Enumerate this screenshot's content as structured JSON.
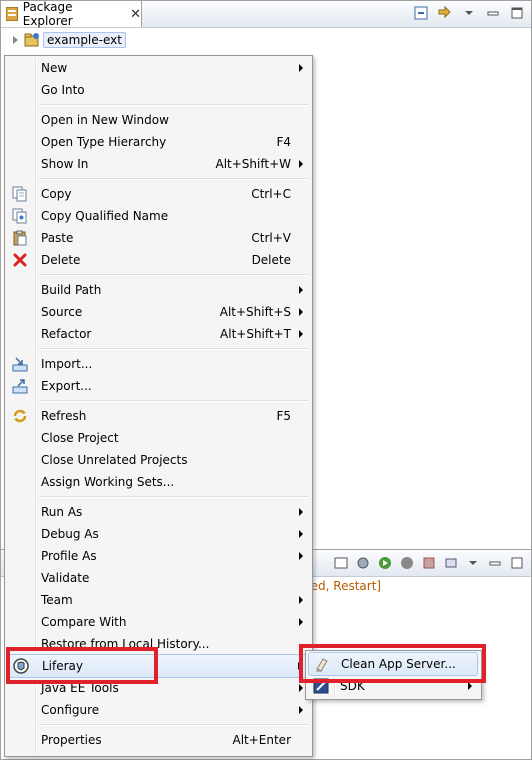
{
  "view": {
    "title": "Package Explorer",
    "close_glyph": "✕",
    "project_label": "example-ext"
  },
  "console": {
    "status_text": "rted, Restart]"
  },
  "menu": {
    "items": [
      {
        "label": "New",
        "shortcut": "",
        "submenu": true,
        "icon": ""
      },
      {
        "label": "Go Into",
        "shortcut": "",
        "submenu": false,
        "icon": ""
      },
      {
        "label": "Open in New Window",
        "shortcut": "",
        "submenu": false,
        "icon": ""
      },
      {
        "label": "Open Type Hierarchy",
        "shortcut": "F4",
        "submenu": false,
        "icon": ""
      },
      {
        "label": "Show In",
        "shortcut": "Alt+Shift+W",
        "submenu": true,
        "icon": ""
      },
      {
        "label": "Copy",
        "shortcut": "Ctrl+C",
        "submenu": false,
        "icon": "copy-icon"
      },
      {
        "label": "Copy Qualified Name",
        "shortcut": "",
        "submenu": false,
        "icon": "copy-qualified-icon"
      },
      {
        "label": "Paste",
        "shortcut": "Ctrl+V",
        "submenu": false,
        "icon": "paste-icon"
      },
      {
        "label": "Delete",
        "shortcut": "Delete",
        "submenu": false,
        "icon": "delete-icon"
      },
      {
        "label": "Build Path",
        "shortcut": "",
        "submenu": true,
        "icon": ""
      },
      {
        "label": "Source",
        "shortcut": "Alt+Shift+S",
        "submenu": true,
        "icon": ""
      },
      {
        "label": "Refactor",
        "shortcut": "Alt+Shift+T",
        "submenu": true,
        "icon": ""
      },
      {
        "label": "Import...",
        "shortcut": "",
        "submenu": false,
        "icon": "import-icon"
      },
      {
        "label": "Export...",
        "shortcut": "",
        "submenu": false,
        "icon": "export-icon"
      },
      {
        "label": "Refresh",
        "shortcut": "F5",
        "submenu": false,
        "icon": "refresh-icon"
      },
      {
        "label": "Close Project",
        "shortcut": "",
        "submenu": false,
        "icon": ""
      },
      {
        "label": "Close Unrelated Projects",
        "shortcut": "",
        "submenu": false,
        "icon": ""
      },
      {
        "label": "Assign Working Sets...",
        "shortcut": "",
        "submenu": false,
        "icon": ""
      },
      {
        "label": "Run As",
        "shortcut": "",
        "submenu": true,
        "icon": ""
      },
      {
        "label": "Debug As",
        "shortcut": "",
        "submenu": true,
        "icon": ""
      },
      {
        "label": "Profile As",
        "shortcut": "",
        "submenu": true,
        "icon": ""
      },
      {
        "label": "Validate",
        "shortcut": "",
        "submenu": false,
        "icon": ""
      },
      {
        "label": "Team",
        "shortcut": "",
        "submenu": true,
        "icon": ""
      },
      {
        "label": "Compare With",
        "shortcut": "",
        "submenu": true,
        "icon": ""
      },
      {
        "label": "Restore from Local History...",
        "shortcut": "",
        "submenu": false,
        "icon": ""
      },
      {
        "label": "Liferay",
        "shortcut": "",
        "submenu": true,
        "icon": "liferay-icon"
      },
      {
        "label": "Java EE Tools",
        "shortcut": "",
        "submenu": true,
        "icon": ""
      },
      {
        "label": "Configure",
        "shortcut": "",
        "submenu": true,
        "icon": ""
      },
      {
        "label": "Properties",
        "shortcut": "Alt+Enter",
        "submenu": false,
        "icon": ""
      }
    ]
  },
  "submenu": {
    "items": [
      {
        "label": "Clean App Server...",
        "submenu": false,
        "icon": "clean-app-server-icon"
      },
      {
        "label": "SDK",
        "submenu": true,
        "icon": "sdk-icon"
      }
    ]
  },
  "colors": {
    "highlight_box": "#e0202a",
    "console_text": "#b85a00"
  }
}
